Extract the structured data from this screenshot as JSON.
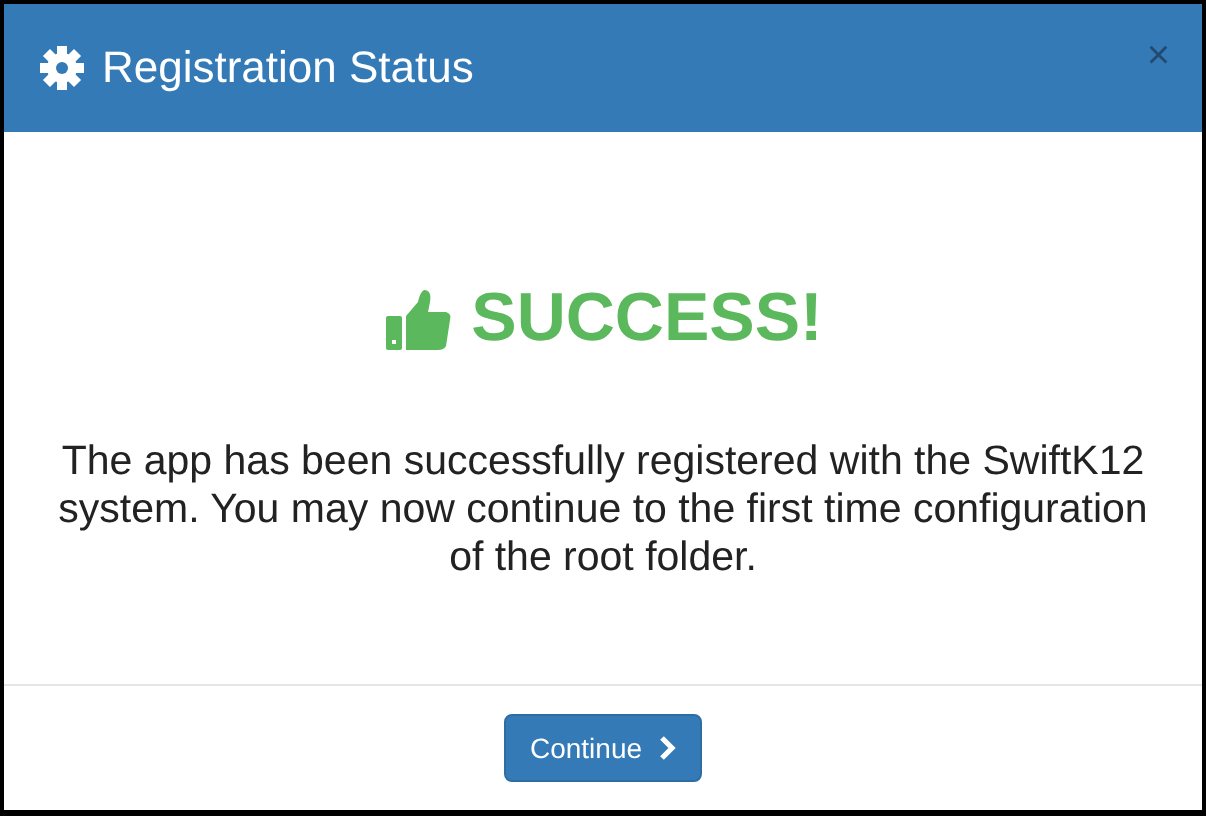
{
  "dialog": {
    "title": "Registration Status",
    "close": "×",
    "heading": "SUCCESS!",
    "message": "The app has been successfully registered with the SwiftK12 system. You may now continue to the first time configuration of the root folder.",
    "buttons": [
      {
        "label": "Continue",
        "kind": "primary"
      }
    ]
  }
}
